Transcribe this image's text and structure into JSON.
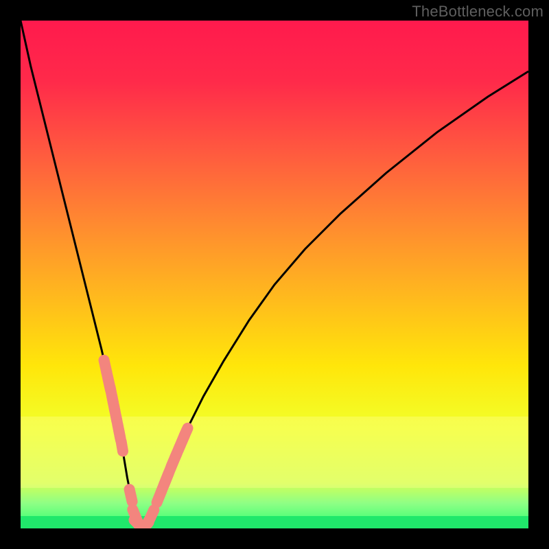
{
  "watermark": "TheBottleneck.com",
  "colors": {
    "frame": "#000000",
    "curve": "#000000",
    "marker": "#f3857e",
    "green": "#20e86b"
  },
  "chart_data": {
    "type": "line",
    "title": "",
    "xlabel": "",
    "ylabel": "",
    "xlim": [
      0,
      100
    ],
    "ylim": [
      0,
      100
    ],
    "grid": false,
    "legend": false,
    "series": [
      {
        "name": "bottleneck-curve",
        "x": [
          0,
          2,
          4,
          6,
          8,
          10,
          12,
          14,
          16,
          18,
          19,
          20,
          21,
          22,
          23,
          24,
          25,
          26,
          28,
          30,
          33,
          36,
          40,
          45,
          50,
          56,
          63,
          72,
          82,
          92,
          100
        ],
        "y": [
          100,
          91,
          83,
          75,
          67,
          59,
          51,
          43,
          35,
          26,
          21,
          16,
          10,
          5,
          1,
          0,
          1,
          3,
          8,
          13,
          20,
          26,
          33,
          41,
          48,
          55,
          62,
          70,
          78,
          85,
          90
        ]
      }
    ],
    "markers": [
      {
        "x_range": [
          16.5,
          20.5
        ],
        "y_range": [
          8,
          34
        ],
        "count": 10
      },
      {
        "x_range": [
          21.5,
          26.0
        ],
        "y_range": [
          0,
          6
        ],
        "count": 6
      },
      {
        "x_range": [
          27.0,
          33.5
        ],
        "y_range": [
          8,
          30
        ],
        "count": 9
      }
    ],
    "bands": [
      {
        "name": "pale-yellow",
        "y_range": [
          8,
          22
        ]
      },
      {
        "name": "green",
        "y_range": [
          0,
          2.5
        ]
      }
    ]
  }
}
